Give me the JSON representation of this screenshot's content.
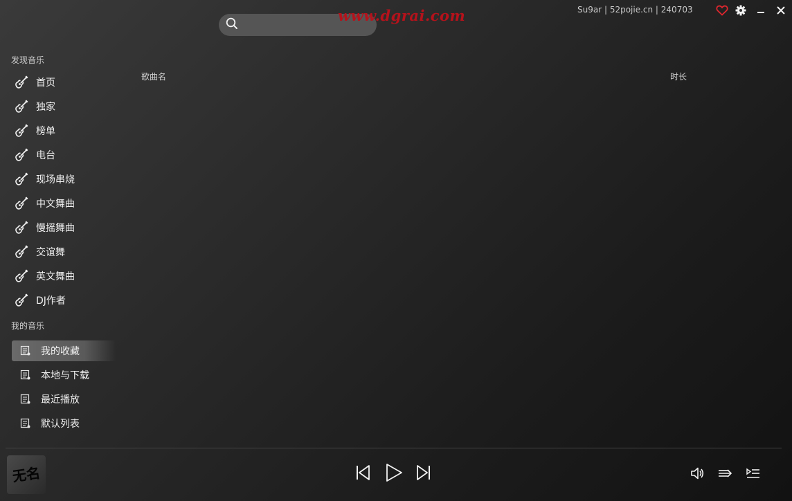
{
  "search": {
    "placeholder": "",
    "icon": "search-icon"
  },
  "watermark": "www.dgrai.com",
  "top_info": "Su9ar | 52pojie.cn | 240703",
  "colors": {
    "heart": "#e0262e",
    "watermark": "#b5121b",
    "active_item": "#5f5f5f"
  },
  "discover": {
    "title": "发现音乐",
    "items": [
      {
        "label": "首页",
        "icon": "guitar-icon"
      },
      {
        "label": "独家",
        "icon": "guitar-icon"
      },
      {
        "label": "榜单",
        "icon": "guitar-icon"
      },
      {
        "label": "电台",
        "icon": "guitar-icon"
      },
      {
        "label": "现场串烧",
        "icon": "guitar-icon"
      },
      {
        "label": "中文舞曲",
        "icon": "guitar-icon"
      },
      {
        "label": "慢摇舞曲",
        "icon": "guitar-icon"
      },
      {
        "label": "交谊舞",
        "icon": "guitar-icon"
      },
      {
        "label": "英文舞曲",
        "icon": "guitar-icon"
      },
      {
        "label": "DJ作者",
        "icon": "guitar-icon"
      }
    ]
  },
  "my_music": {
    "title": "我的音乐",
    "items": [
      {
        "label": "我的收藏",
        "icon": "playlist-icon",
        "active": true
      },
      {
        "label": "本地与下载",
        "icon": "playlist-icon"
      },
      {
        "label": "最近播放",
        "icon": "playlist-icon"
      },
      {
        "label": "默认列表",
        "icon": "playlist-icon"
      }
    ]
  },
  "table": {
    "columns": [
      "歌曲名",
      "时长"
    ],
    "rows": []
  },
  "player": {
    "cover_text": "无名"
  }
}
